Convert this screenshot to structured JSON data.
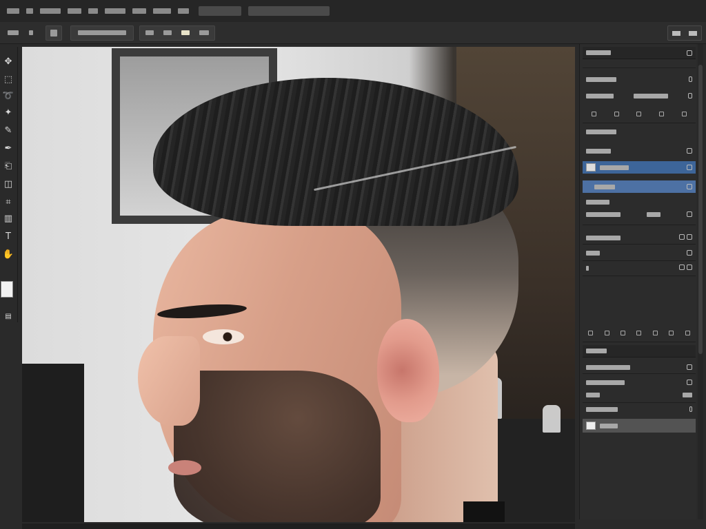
{
  "menubar": {
    "items": [
      {
        "label": ""
      },
      {
        "label": ""
      },
      {
        "label": ""
      },
      {
        "label": ""
      },
      {
        "label": ""
      },
      {
        "label": ""
      },
      {
        "label": ""
      },
      {
        "label": ""
      },
      {
        "label": ""
      }
    ],
    "field_1": "",
    "field_2": ""
  },
  "optionsbar": {
    "tool_preset": "",
    "mode": "",
    "right_label": ""
  },
  "toolbar": {
    "tools": [
      {
        "name": "move-icon",
        "glyph": "✥"
      },
      {
        "name": "marquee-icon",
        "glyph": "⬚"
      },
      {
        "name": "lasso-icon",
        "glyph": "➰"
      },
      {
        "name": "magic-wand-icon",
        "glyph": "✦"
      },
      {
        "name": "crop-icon",
        "glyph": "⌗"
      },
      {
        "name": "brush-icon",
        "glyph": "✎"
      },
      {
        "name": "stamp-icon",
        "glyph": "⎗"
      },
      {
        "name": "eraser-icon",
        "glyph": "◫"
      },
      {
        "name": "gradient-icon",
        "glyph": "▥"
      },
      {
        "name": "pen-icon",
        "glyph": "✒"
      },
      {
        "name": "text-icon",
        "glyph": "T"
      },
      {
        "name": "shape-icon",
        "glyph": "▭"
      },
      {
        "name": "hand-icon",
        "glyph": "✋"
      },
      {
        "name": "zoom-icon",
        "glyph": "⌕"
      }
    ]
  },
  "canvas": {
    "description_color_hair": "#252525",
    "description_color_skin": "#d79f88"
  },
  "panel": {
    "tab_header": "",
    "section1_title": "",
    "section1_sub": "",
    "section2_title": "",
    "layers": [
      {
        "label": "",
        "state": "normal"
      },
      {
        "label": "",
        "state": "selected"
      },
      {
        "label": "",
        "state": "selected2"
      },
      {
        "label": "",
        "state": "normal"
      },
      {
        "label": "",
        "state": "normal"
      }
    ],
    "adjust_rows": [
      {
        "label": ""
      },
      {
        "label": ""
      },
      {
        "label": ""
      }
    ],
    "lower_rows": [
      {
        "label": ""
      },
      {
        "label": ""
      },
      {
        "label": ""
      },
      {
        "label": ""
      },
      {
        "label": ""
      },
      {
        "label": "",
        "state": "gray"
      }
    ]
  },
  "colors": {
    "accent_selection": "#3d6599",
    "panel_bg": "#2c2c2c",
    "app_bg": "#2a2a2a"
  }
}
